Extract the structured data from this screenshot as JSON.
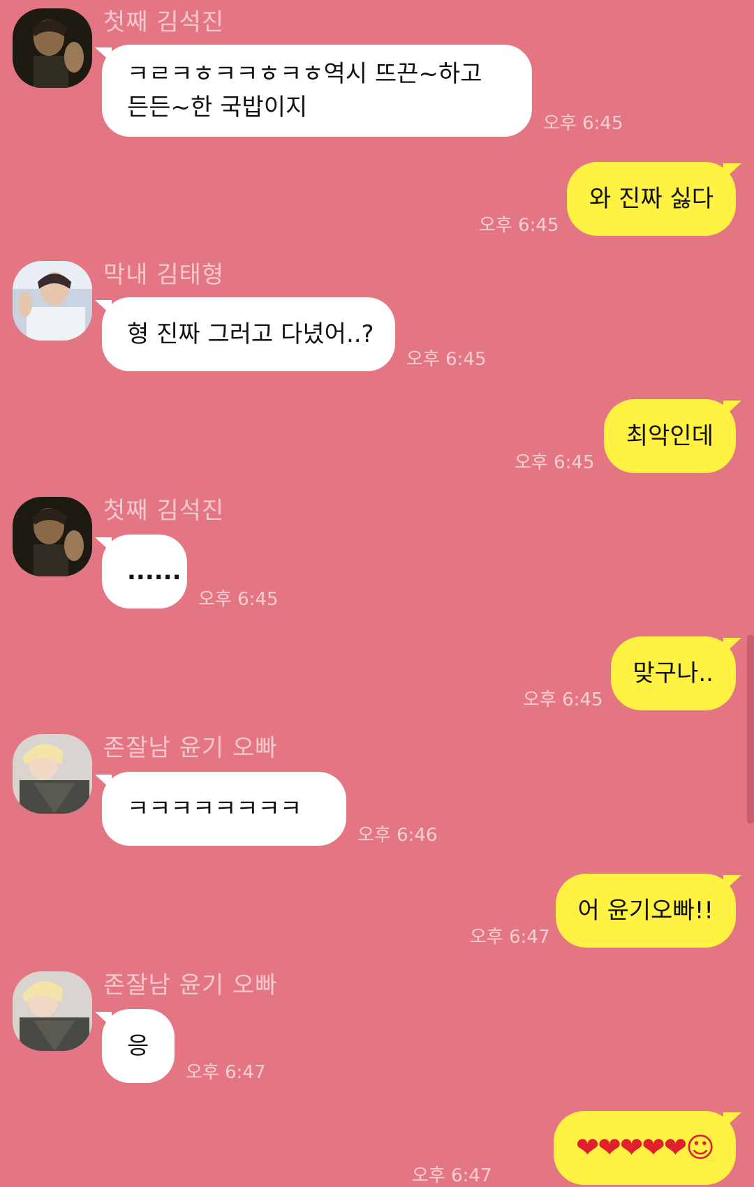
{
  "messages": [
    {
      "dir": "in",
      "sender": "첫째 김석진",
      "avatar": "jin",
      "text": "ㅋㄹㅋㅎㅋㅋㅎㅋㅎ역시 뜨끈~하고\n든든~한 국밥이지",
      "time": "오후 6:45"
    },
    {
      "dir": "out",
      "text": "와 진짜 싫다",
      "time": "오후 6:45"
    },
    {
      "dir": "in",
      "sender": "막내 김태형",
      "avatar": "tae",
      "text": "형 진짜 그러고 다녔어..?",
      "time": "오후 6:45"
    },
    {
      "dir": "out",
      "text": "최악인데",
      "time": "오후 6:45"
    },
    {
      "dir": "in",
      "sender": "첫째 김석진",
      "avatar": "jin",
      "text": "......",
      "time": "오후 6:45"
    },
    {
      "dir": "out",
      "text": "맞구나..",
      "time": "오후 6:45"
    },
    {
      "dir": "in",
      "sender": "존잘남 윤기 오빠",
      "avatar": "yoongi",
      "text": "ㅋㅋㅋㅋㅋㅋㅋㅋ",
      "time": "오후 6:46"
    },
    {
      "dir": "out",
      "text": "어 윤기오빠!!",
      "time": "오후 6:47"
    },
    {
      "dir": "in",
      "sender": "존잘남 윤기 오빠",
      "avatar": "yoongi",
      "text": "응",
      "time": "오후 6:47"
    },
    {
      "dir": "out",
      "text": "❤❤❤❤❤☺",
      "time": "오후 6:47"
    }
  ],
  "colors": {
    "background": "#e47684",
    "incoming_bubble": "#ffffff",
    "outgoing_bubble": "#fff243"
  }
}
